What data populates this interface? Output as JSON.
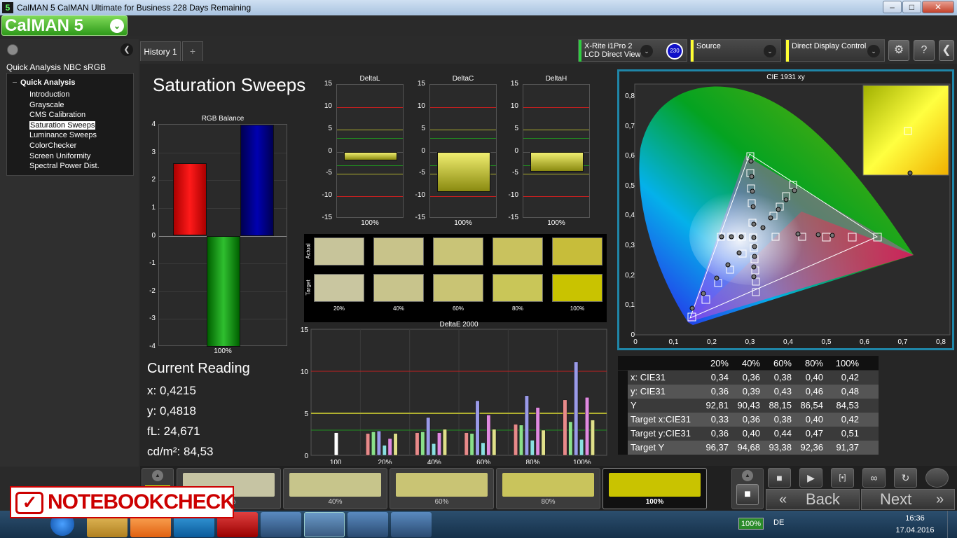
{
  "window": {
    "title": "CalMAN 5 CalMAN Ultimate for Business 228 Days Remaining",
    "app_icon": "5",
    "min": "–",
    "max": "□",
    "close": "✕"
  },
  "logo": {
    "text": "CalMAN 5",
    "dropdown": "⌄"
  },
  "left_panel": {
    "heading": "Quick Analysis NBC sRGB",
    "tree_root": "Quick Analysis",
    "items": [
      "Introduction",
      "Grayscale",
      "CMS Calibration",
      "Saturation Sweeps",
      "Luminance Sweeps",
      "ColorChecker",
      "Screen Uniformity",
      "Spectral Power Dist."
    ],
    "selected_index": 3
  },
  "tabs": {
    "history": "History 1",
    "add": "+"
  },
  "devices": {
    "meter_line1": "X-Rite i1Pro 2",
    "meter_line2": "LCD Direct View",
    "meter_badge": "230",
    "meter_color": "#2ecc40",
    "source": "Source",
    "source_color": "#ffff33",
    "display": "Direct Display Control",
    "display_color": "#ffff33",
    "chevron": "⌄"
  },
  "toolbar": {
    "settings_icon": "⚙",
    "help_icon": "?",
    "collapse_icon": "❮"
  },
  "page_title": "Saturation Sweeps",
  "rgb_balance": {
    "title": "RGB Balance",
    "ylim": [
      -4,
      4
    ],
    "ticks": [
      "4",
      "3",
      "2",
      "1",
      "0",
      "-1",
      "-2",
      "-3",
      "-4"
    ],
    "xlabel": "100%",
    "red": 2.6,
    "green": -4,
    "blue": 4,
    "colors": {
      "red": "#ff0000",
      "green": "#00a000",
      "blue": "#000090"
    }
  },
  "delta_charts": [
    {
      "title": "DeltaL",
      "xlabel": "100%",
      "value": -2
    },
    {
      "title": "DeltaC",
      "xlabel": "100%",
      "value": -9
    },
    {
      "title": "DeltaH",
      "xlabel": "100%",
      "value": -4.5
    }
  ],
  "delta_ticks": [
    "15",
    "10",
    "5",
    "0",
    "-5",
    "-10",
    "-15"
  ],
  "swatches": {
    "actual_label": "Actual",
    "target_label": "Target",
    "levels": [
      "20%",
      "40%",
      "60%",
      "80%",
      "100%"
    ],
    "actual": [
      "#c7c49a",
      "#c8c38a",
      "#c9c477",
      "#c9c25e",
      "#c7bd3a"
    ],
    "target": [
      "#c9c6a0",
      "#c8c48c",
      "#c9c474",
      "#c9c658",
      "#c9c300"
    ]
  },
  "chart_data": {
    "type": "bar",
    "title": "DeltaE 2000",
    "ylim": [
      0,
      15
    ],
    "yticks": [
      "15",
      "10",
      "5",
      "0"
    ],
    "categories": [
      "100",
      "20%",
      "40%",
      "60%",
      "80%",
      "100%"
    ],
    "thresholds": [
      10,
      5,
      3
    ],
    "series": [
      {
        "values": [
          2.7,
          2.6,
          2.7,
          2.7,
          3.7,
          6.6
        ],
        "color": "#e88a8a"
      },
      {
        "values": [
          null,
          2.8,
          2.8,
          2.6,
          3.6,
          4.0
        ],
        "color": "#8ae08a"
      },
      {
        "values": [
          null,
          2.9,
          4.5,
          6.5,
          7.1,
          11.1
        ],
        "color": "#9a9ae8"
      },
      {
        "values": [
          null,
          1.2,
          1.4,
          1.5,
          1.8,
          1.9
        ],
        "color": "#8ae0e0"
      },
      {
        "values": [
          null,
          2.0,
          2.7,
          4.8,
          5.7,
          6.9
        ],
        "color": "#e08ae0"
      },
      {
        "values": [
          null,
          2.6,
          3.1,
          3.1,
          3.0,
          4.2
        ],
        "color": "#e0e08a"
      }
    ]
  },
  "current_reading": {
    "title": "Current Reading",
    "x": "x: 0,4215",
    "y": "y: 0,4818",
    "fl": "fL: 24,671",
    "cd": "cd/m²: 84,53"
  },
  "cie": {
    "title": "CIE 1931 xy",
    "xticks": [
      "0",
      "0,1",
      "0,2",
      "0,3",
      "0,4",
      "0,5",
      "0,6",
      "0,7",
      "0,8"
    ],
    "yticks": [
      "0,8",
      "0,7",
      "0,6",
      "0,5",
      "0,4",
      "0,3",
      "0,2",
      "0,1",
      "0"
    ]
  },
  "table": {
    "headers": [
      "20%",
      "40%",
      "60%",
      "80%",
      "100%"
    ],
    "rows": [
      {
        "label": "x: CIE31",
        "values": [
          "0,34",
          "0,36",
          "0,38",
          "0,40",
          "0,42"
        ]
      },
      {
        "label": "y: CIE31",
        "values": [
          "0,36",
          "0,39",
          "0,43",
          "0,46",
          "0,48"
        ]
      },
      {
        "label": "Y",
        "values": [
          "92,81",
          "90,43",
          "88,15",
          "86,54",
          "84,53"
        ]
      },
      {
        "label": "Target x:CIE31",
        "values": [
          "0,33",
          "0,36",
          "0,38",
          "0,40",
          "0,42"
        ]
      },
      {
        "label": "Target y:CIE31",
        "values": [
          "0,36",
          "0,40",
          "0,44",
          "0,47",
          "0,51"
        ]
      },
      {
        "label": "Target Y",
        "values": [
          "96,37",
          "94,68",
          "93,38",
          "92,36",
          "91,37"
        ]
      }
    ]
  },
  "bottom_swatches": [
    {
      "label": "20%",
      "color": "#c6c4a3"
    },
    {
      "label": "40%",
      "color": "#c7c58b"
    },
    {
      "label": "60%",
      "color": "#c9c474"
    },
    {
      "label": "80%",
      "color": "#c9c45c"
    },
    {
      "label": "100%",
      "color": "#c9c300"
    }
  ],
  "bottom_active_color": "#ffff00",
  "nav": {
    "back": "Back",
    "next": "Next",
    "back_icon": "«",
    "next_icon": "»",
    "stop": "■",
    "play": "▶",
    "step": "[•]",
    "loop": "∞",
    "sync": "↻"
  },
  "watermark": {
    "text": "NOTEBOOKCHECK",
    "mark": "✓"
  },
  "taskbar": {
    "battery": "100%",
    "lang": "DE",
    "time": "16:36",
    "date": "17.04.2016"
  }
}
